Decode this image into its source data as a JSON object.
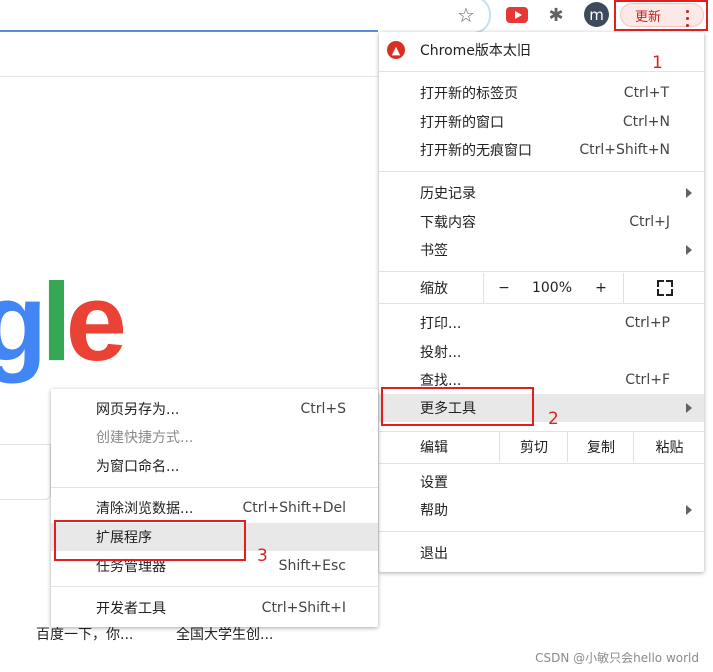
{
  "toolbar": {
    "avatar_letter": "m",
    "update_label": "更新"
  },
  "page": {
    "logo_g": "g",
    "logo_l": "l",
    "logo_e": "e",
    "bottom_link1": "百度一下，你...",
    "bottom_link2": "全国大学生创...",
    "watermark": "CSDN @小敏只会hello world"
  },
  "annotations": {
    "n1": "1",
    "n2": "2",
    "n3": "3"
  },
  "menu": {
    "update_item": "Chrome版本太旧",
    "new_tab": {
      "label": "打开新的标签页",
      "shortcut": "Ctrl+T"
    },
    "new_window": {
      "label": "打开新的窗口",
      "shortcut": "Ctrl+N"
    },
    "incognito": {
      "label": "打开新的无痕窗口",
      "shortcut": "Ctrl+Shift+N"
    },
    "history": {
      "label": "历史记录"
    },
    "downloads": {
      "label": "下载内容",
      "shortcut": "Ctrl+J"
    },
    "bookmarks": {
      "label": "书签"
    },
    "zoom": {
      "label": "缩放",
      "minus": "−",
      "value": "100%",
      "plus": "+"
    },
    "print": {
      "label": "打印...",
      "shortcut": "Ctrl+P"
    },
    "cast": {
      "label": "投射..."
    },
    "find": {
      "label": "查找...",
      "shortcut": "Ctrl+F"
    },
    "more_tools": {
      "label": "更多工具"
    },
    "edit": {
      "label": "编辑",
      "cut": "剪切",
      "copy": "复制",
      "paste": "粘贴"
    },
    "settings": {
      "label": "设置"
    },
    "help": {
      "label": "帮助"
    },
    "exit": {
      "label": "退出"
    }
  },
  "submenu": {
    "save_page": {
      "label": "网页另存为...",
      "shortcut": "Ctrl+S"
    },
    "create_shortcut": {
      "label": "创建快捷方式..."
    },
    "name_window": {
      "label": "为窗口命名..."
    },
    "clear_data": {
      "label": "清除浏览数据...",
      "shortcut": "Ctrl+Shift+Del"
    },
    "extensions": {
      "label": "扩展程序"
    },
    "task_manager": {
      "label": "任务管理器",
      "shortcut": "Shift+Esc"
    },
    "dev_tools": {
      "label": "开发者工具",
      "shortcut": "Ctrl+Shift+I"
    }
  }
}
